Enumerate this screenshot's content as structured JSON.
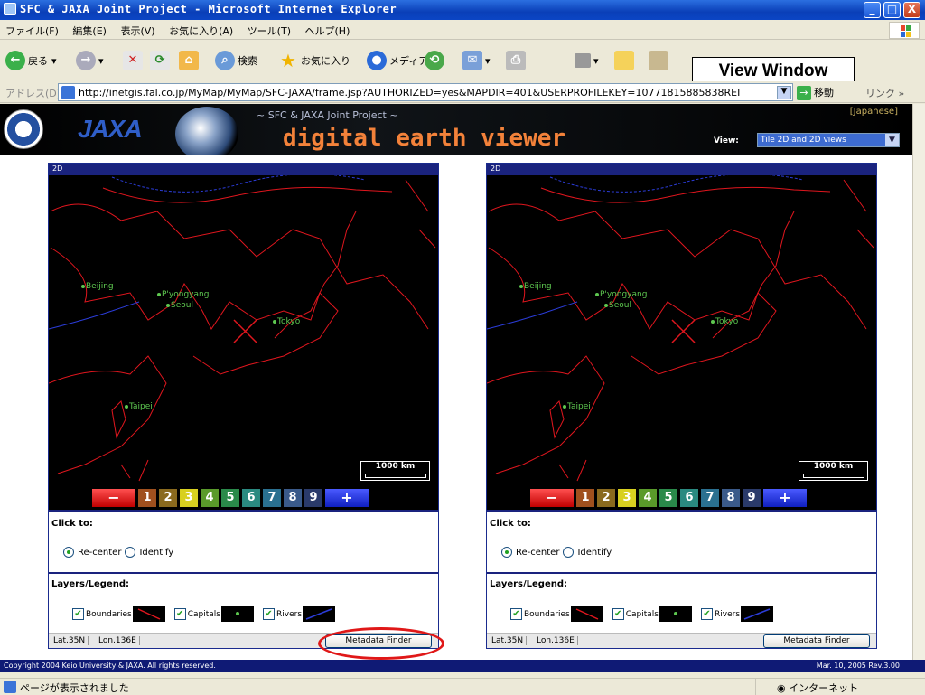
{
  "window": {
    "title": "SFC & JAXA Joint Project - Microsoft Internet Explorer",
    "minimize_label": "_",
    "maximize_label": "□",
    "close_label": "X"
  },
  "menu": [
    "ファイル(F)",
    "編集(E)",
    "表示(V)",
    "お気に入り(A)",
    "ツール(T)",
    "ヘルプ(H)"
  ],
  "toolbar": {
    "back": "戻る",
    "search": "検索",
    "favorites": "お気に入り",
    "media": "メディア"
  },
  "annotation": {
    "view_window": "View Window"
  },
  "address": {
    "label": "アドレス(D)",
    "url": "http://inetgis.fal.co.jp/MyMap/MyMap/SFC-JAXA/frame.jsp?AUTHORIZED=yes&MAPDIR=401&USERPROFILEKEY=10771815885838REI",
    "go": "移動",
    "links": "リンク »"
  },
  "banner": {
    "logo": "JAXA",
    "subtitle": "~ SFC & JAXA Joint Project ~",
    "title": "digital earth viewer",
    "japanese_link": "[Japanese]",
    "view_label": "View:",
    "view_selected": "Tile 2D and 2D views"
  },
  "panels": [
    {
      "header": "2D",
      "scale_label": "1000 km",
      "zoom": {
        "minus": "−",
        "plus": "+",
        "levels": [
          "1",
          "2",
          "3",
          "4",
          "5",
          "6",
          "7",
          "8",
          "9"
        ]
      },
      "cities": [
        "Beijing",
        "P'yongyang",
        "Seoul",
        "Tokyo",
        "Taipei"
      ],
      "click_to_label": "Click to:",
      "recenter_label": "Re-center",
      "identify_label": "Identify",
      "layers_label": "Layers/Legend:",
      "layer_boundaries": "Boundaries",
      "layer_capitals": "Capitals",
      "layer_rivers": "Rivers",
      "lat": "Lat.35N",
      "lon": "Lon.136E",
      "metadata_button": "Metadata Finder"
    },
    {
      "header": "2D",
      "scale_label": "1000 km",
      "zoom": {
        "minus": "−",
        "plus": "+",
        "levels": [
          "1",
          "2",
          "3",
          "4",
          "5",
          "6",
          "7",
          "8",
          "9"
        ]
      },
      "cities": [
        "Beijing",
        "P'yongyang",
        "Seoul",
        "Tokyo",
        "Taipei"
      ],
      "click_to_label": "Click to:",
      "recenter_label": "Re-center",
      "identify_label": "Identify",
      "layers_label": "Layers/Legend:",
      "layer_boundaries": "Boundaries",
      "layer_capitals": "Capitals",
      "layer_rivers": "Rivers",
      "lat": "Lat.35N",
      "lon": "Lon.136E",
      "metadata_button": "Metadata Finder"
    }
  ],
  "footer": {
    "copyright": "Copyright 2004 Keio University & JAXA. All rights reserved.",
    "version": "Mar. 10, 2005 Rev.3.00"
  },
  "status": {
    "text": "ページが表示されました",
    "zone": "インターネット"
  },
  "colors": {
    "boundary": "#e0161e",
    "river": "#2b3cd8",
    "capital": "#5ec850",
    "panel_header": "#1a237e"
  }
}
